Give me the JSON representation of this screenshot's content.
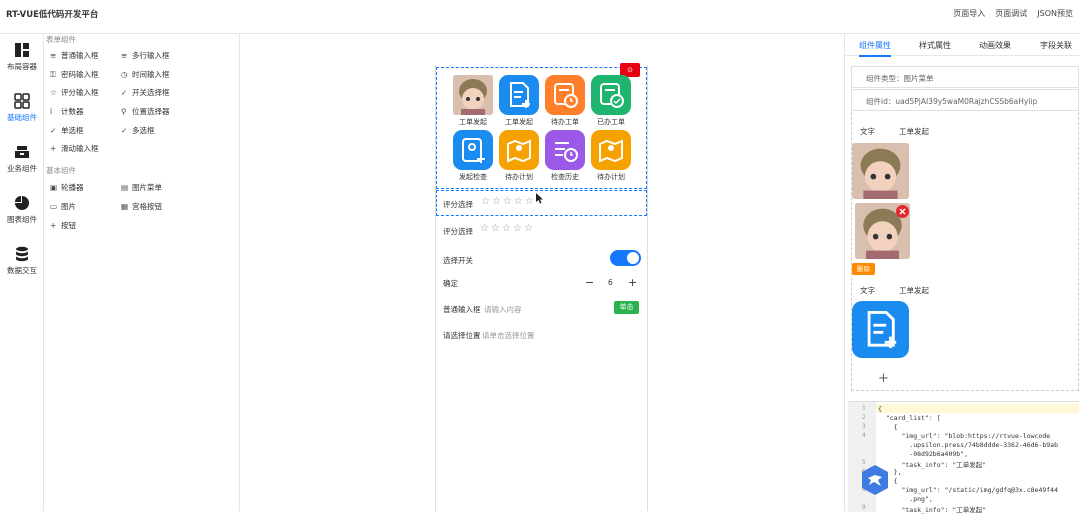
{
  "app": {
    "title": "RT-VUE低代码开发平台"
  },
  "toplinks": [
    "页面导入",
    "页面调试",
    "JSON预览"
  ],
  "leftnav": [
    {
      "label": "布局容器",
      "icon": "layout-icon",
      "active": false
    },
    {
      "label": "基础组件",
      "icon": "grid-icon",
      "active": true
    },
    {
      "label": "业务组件",
      "icon": "business-icon",
      "active": false
    },
    {
      "label": "图表组件",
      "icon": "pie-chart-icon",
      "active": false
    },
    {
      "label": "数据交互",
      "icon": "database-icon",
      "active": false
    }
  ],
  "components": {
    "form_section": "表单组件",
    "form_items": [
      {
        "label": "普通输入框",
        "icon": "≡"
      },
      {
        "label": "多行输入框",
        "icon": "≡"
      },
      {
        "label": "密码输入框",
        "icon": "⚿"
      },
      {
        "label": "时间输入框",
        "icon": "◷"
      },
      {
        "label": "评分输入框",
        "icon": "☆"
      },
      {
        "label": "开关选择框",
        "icon": "✓"
      },
      {
        "label": "计数器",
        "icon": "ⅰ"
      },
      {
        "label": "位置选择器",
        "icon": "⚲"
      },
      {
        "label": "单选框",
        "icon": "✓"
      },
      {
        "label": "多选框",
        "icon": "✓"
      },
      {
        "label": "滑动输入框",
        "icon": "+"
      }
    ],
    "basic_section": "基本组件",
    "basic_items": [
      {
        "label": "轮播器",
        "icon": "▣"
      },
      {
        "label": "图片菜单",
        "icon": "▤"
      },
      {
        "label": "图片",
        "icon": "▭"
      },
      {
        "label": "宫格按钮",
        "icon": "▦"
      },
      {
        "label": "按钮",
        "icon": "+"
      }
    ]
  },
  "canvas": {
    "menu_tiles": [
      {
        "label": "工单发起",
        "type": "avatar",
        "color": "#c9a89a"
      },
      {
        "label": "工单发起",
        "type": "icon",
        "color": "#1a8cf0"
      },
      {
        "label": "待办工单",
        "type": "icon",
        "color": "#ff7f2a"
      },
      {
        "label": "已办工单",
        "type": "icon",
        "color": "#1fb46e"
      },
      {
        "label": "发起检查",
        "type": "icon",
        "color": "#1a8cf0"
      },
      {
        "label": "待办计划",
        "type": "icon",
        "color": "#f5a100"
      },
      {
        "label": "检查历史",
        "type": "icon",
        "color": "#9b59e8"
      },
      {
        "label": "待办计划",
        "type": "icon",
        "color": "#f5a100"
      }
    ],
    "rating1_label": "评分选择",
    "rating2_label": "评分选择",
    "switch_label": "选择开关",
    "stepper_label": "确定",
    "stepper_minus": "−",
    "stepper_value": "6",
    "stepper_plus": "+",
    "input_label": "普通输入框",
    "input_placeholder": "请输入内容",
    "input_button": "单击",
    "location_label": "请选择位置",
    "location_placeholder": "请单击选择位置",
    "stars": "☆☆☆☆☆",
    "red_button_icon": "⊙"
  },
  "right": {
    "tabs": [
      "组件属性",
      "样式属性",
      "动画效果",
      "字段关联"
    ],
    "component_type": "组件类型：图片菜单",
    "component_id": "组件id：uad5PjAI39y5waM0RajzhCSSb6aHylip",
    "card1_text_label": "文字",
    "card1_text_value": "工单发起",
    "delete_label": "删除",
    "card2_text_label": "文字",
    "card2_text_value": "工单发起",
    "add_symbol": "+"
  },
  "editor": {
    "line_numbers": [
      "1",
      "2",
      "3",
      "4",
      "",
      "",
      "5",
      "6",
      "7",
      "8",
      "",
      "9"
    ],
    "lines": [
      "{",
      "  \"card_list\": [",
      "    {",
      "      \"img_url\": \"blob:https://rtvue-lowcode",
      "        .upsilon.press/74b8ddde-3362-46d6-b9ab",
      "        -08d92b6a409b\",",
      "      \"task_info\": \"工单发起\"",
      "    },",
      "    {",
      "      \"img_url\": \"/static/img/gdfq@3x.c8e49f44",
      "        .png\",",
      "      \"task_info\": \"工单发起\""
    ]
  }
}
